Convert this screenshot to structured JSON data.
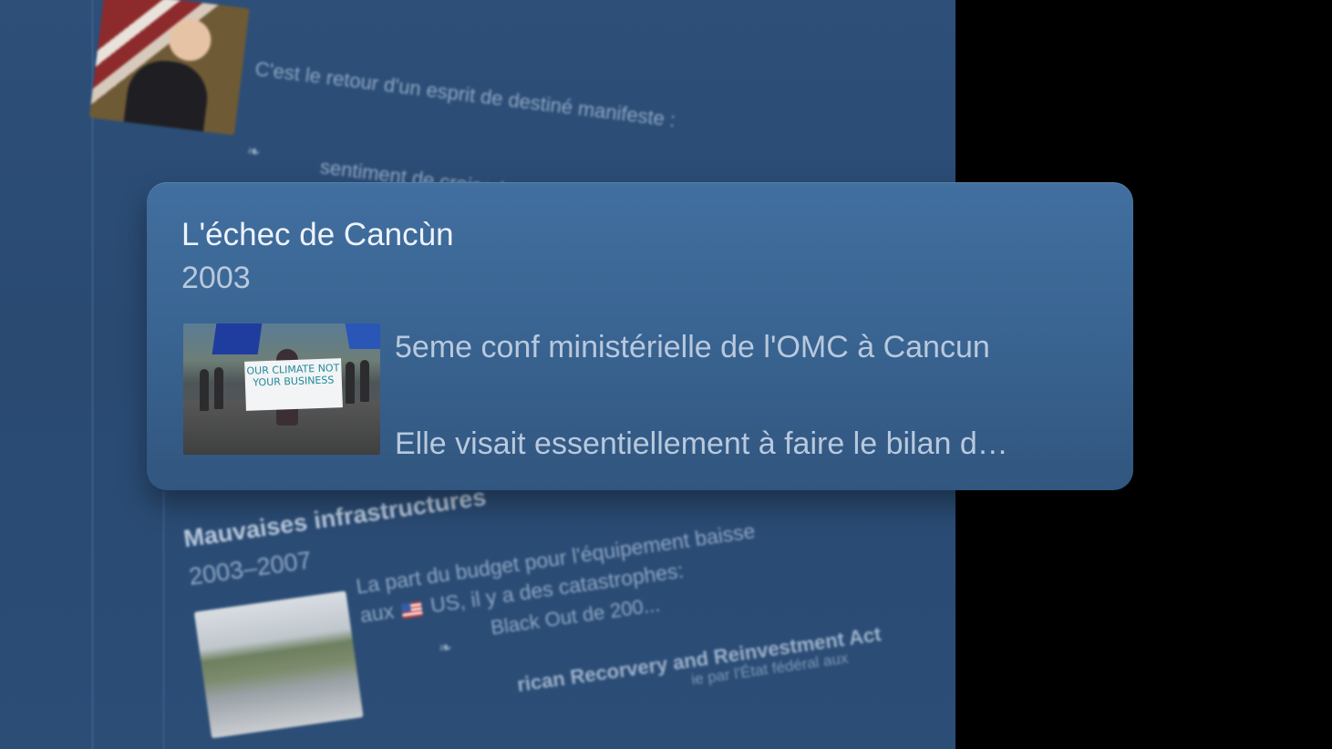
{
  "background_panel": {
    "top_entry": {
      "line1": "C'est le retour d'un esprit de destiné manifeste :",
      "line2": "sentiment de croisad"
    },
    "bottom_entry": {
      "title": "Mauvaises infrastructures",
      "years": "2003–2007",
      "line1": "La part du budget pour l'équipement baisse",
      "line2_prefix": "aux",
      "line2_suffix": "US, il y a des catastrophes:",
      "line3": "Black Out de 200...",
      "line4": "rican Recorvery and Reinvestment Act",
      "line5": "ie par l'État fédéral aux"
    }
  },
  "focused_card": {
    "title": "L'échec de Cancùn",
    "year": "2003",
    "summary": "5eme conf ministérielle de l'OMC à Cancun",
    "detail": "Elle visait essentiellement à faire le bilan d…",
    "image_sign_text": "OUR CLIMATE NOT YOUR BUSINESS"
  },
  "colors": {
    "panel": "#2d4f78",
    "card_top": "#416f9f",
    "card_bottom": "#31567f",
    "title_text": "#edf3fb",
    "secondary_text": "#b8c9dd"
  }
}
